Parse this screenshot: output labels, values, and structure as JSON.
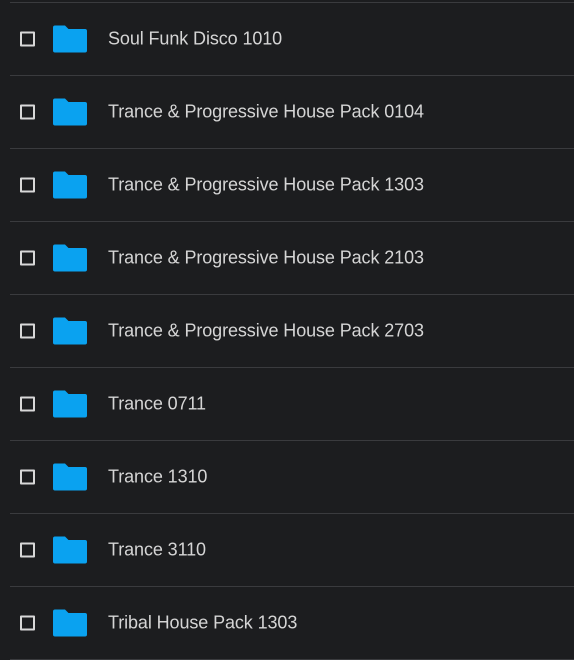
{
  "folder_color": "#0aa2f0",
  "rows": [
    {
      "name": "Soul Funk Disco 1010",
      "checked": false,
      "icon": "folder-icon"
    },
    {
      "name": "Trance & Progressive House Pack 0104",
      "checked": false,
      "icon": "folder-icon"
    },
    {
      "name": "Trance & Progressive House Pack 1303",
      "checked": false,
      "icon": "folder-icon"
    },
    {
      "name": "Trance & Progressive House Pack 2103",
      "checked": false,
      "icon": "folder-icon"
    },
    {
      "name": "Trance & Progressive House Pack 2703",
      "checked": false,
      "icon": "folder-icon"
    },
    {
      "name": "Trance 0711",
      "checked": false,
      "icon": "folder-icon"
    },
    {
      "name": "Trance 1310",
      "checked": false,
      "icon": "folder-icon"
    },
    {
      "name": "Trance 3110",
      "checked": false,
      "icon": "folder-icon"
    },
    {
      "name": "Tribal House Pack 1303",
      "checked": false,
      "icon": "folder-icon"
    }
  ]
}
